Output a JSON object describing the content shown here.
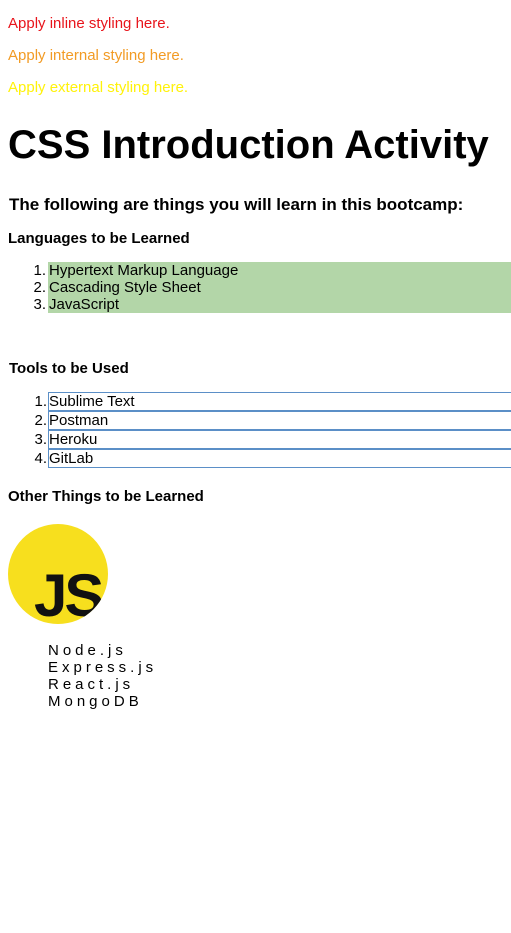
{
  "style_notes": {
    "inline": "Apply inline styling here.",
    "internal": "Apply internal styling here.",
    "external": "Apply external styling here."
  },
  "colors": {
    "inline": "#e8141b",
    "internal": "#f29b24",
    "external": "#fff20a",
    "languages_bg": "#b3d6a8",
    "tools_border": "#5b8fc7",
    "js_logo_bg": "#f7df1e"
  },
  "title": "CSS Introduction Activity",
  "subtitle": "The following are things you will learn in this bootcamp:",
  "languages": {
    "heading": "Languages to be Learned",
    "items": [
      {
        "num": "1.",
        "label": "Hypertext Markup Language"
      },
      {
        "num": "2.",
        "label": "Cascading Style Sheet"
      },
      {
        "num": "3.",
        "label": "JavaScript"
      }
    ]
  },
  "tools": {
    "heading": "Tools to be Used",
    "items": [
      {
        "num": "1.",
        "label": "Sublime Text"
      },
      {
        "num": "2.",
        "label": "Postman"
      },
      {
        "num": "3.",
        "label": "Heroku"
      },
      {
        "num": "4.",
        "label": "GitLab"
      }
    ]
  },
  "other": {
    "heading": "Other Things to be Learned",
    "logo_icon": "javascript-logo-icon",
    "logo_text": "JS",
    "items": [
      "Node.js",
      "Express.js",
      "React.js",
      "MongoDB"
    ]
  }
}
